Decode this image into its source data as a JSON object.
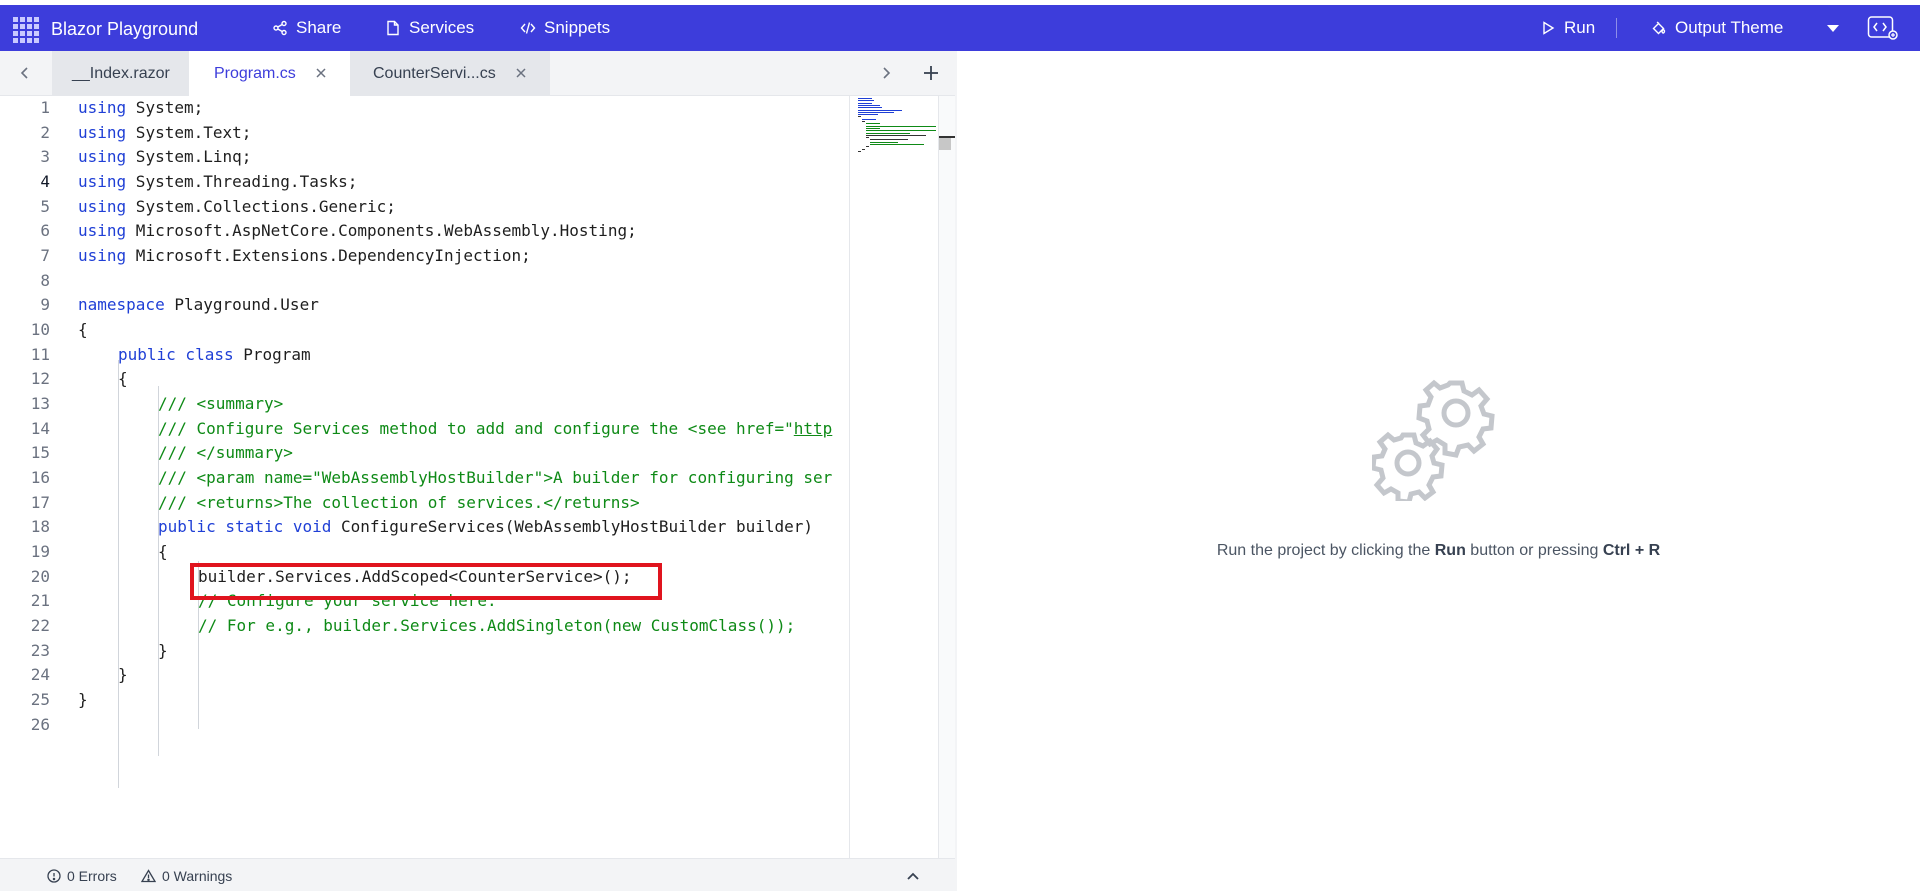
{
  "header": {
    "app_title": "Blazor Playground",
    "nav": {
      "share": "Share",
      "services": "Services",
      "snippets": "Snippets",
      "run": "Run",
      "output_theme": "Output Theme"
    },
    "accent_color": "#3d3ddb"
  },
  "tabs": [
    {
      "label": "__Index.razor",
      "active": false,
      "closable": false
    },
    {
      "label": "Program.cs",
      "active": true,
      "closable": true
    },
    {
      "label": "CounterServi...cs",
      "active": false,
      "closable": true
    }
  ],
  "editor": {
    "line_numbers": [
      "1",
      "2",
      "3",
      "4",
      "5",
      "6",
      "7",
      "8",
      "9",
      "10",
      "11",
      "12",
      "13",
      "14",
      "15",
      "16",
      "17",
      "18",
      "19",
      "20",
      "21",
      "22",
      "23",
      "24",
      "25",
      "26"
    ],
    "current_line": 4,
    "code": {
      "l1_kw": "using",
      "l1_rest": " System;",
      "l2_kw": "using",
      "l2_rest": " System.Text;",
      "l3_kw": "using",
      "l3_rest": " System.Linq;",
      "l4_kw": "using",
      "l4_rest": " System.Threading.Tasks;",
      "l5_kw": "using",
      "l5_rest": " System.Collections.Generic;",
      "l6_kw": "using",
      "l6_rest": " Microsoft.AspNetCore.Components.WebAssembly.Hosting;",
      "l7_kw": "using",
      "l7_rest": " Microsoft.Extensions.DependencyInjection;",
      "l9_kw": "namespace",
      "l9_rest": " Playground.User",
      "l10": "{",
      "l11_kw": "public class",
      "l11_rest": " Program",
      "l12": "{",
      "l13": "/// <summary>",
      "l14_a": "/// Configure Services method to add and configure the <see href=\"",
      "l14_link": "http",
      "l15": "/// </summary>",
      "l16": "/// <param name=\"WebAssemblyHostBuilder\">A builder for configuring ser",
      "l17": "/// <returns>The collection of services.</returns>",
      "l18_kw": "public static void",
      "l18_rest": " ConfigureServices(WebAssemblyHostBuilder builder)",
      "l19": "{",
      "l20": "builder.Services.AddScoped<CounterService>();",
      "l21": "// Configure your service here.",
      "l22": "// For e.g., builder.Services.AddSingleton(new CustomClass());",
      "l23": "}",
      "l24": "}",
      "l25": "}"
    },
    "highlight_color": "#e0141e"
  },
  "status": {
    "errors": "0 Errors",
    "warnings": "0 Warnings"
  },
  "output": {
    "hint_prefix": "Run the project by clicking the ",
    "hint_run": "Run",
    "hint_middle": " button or pressing ",
    "hint_shortcut": "Ctrl + R"
  }
}
